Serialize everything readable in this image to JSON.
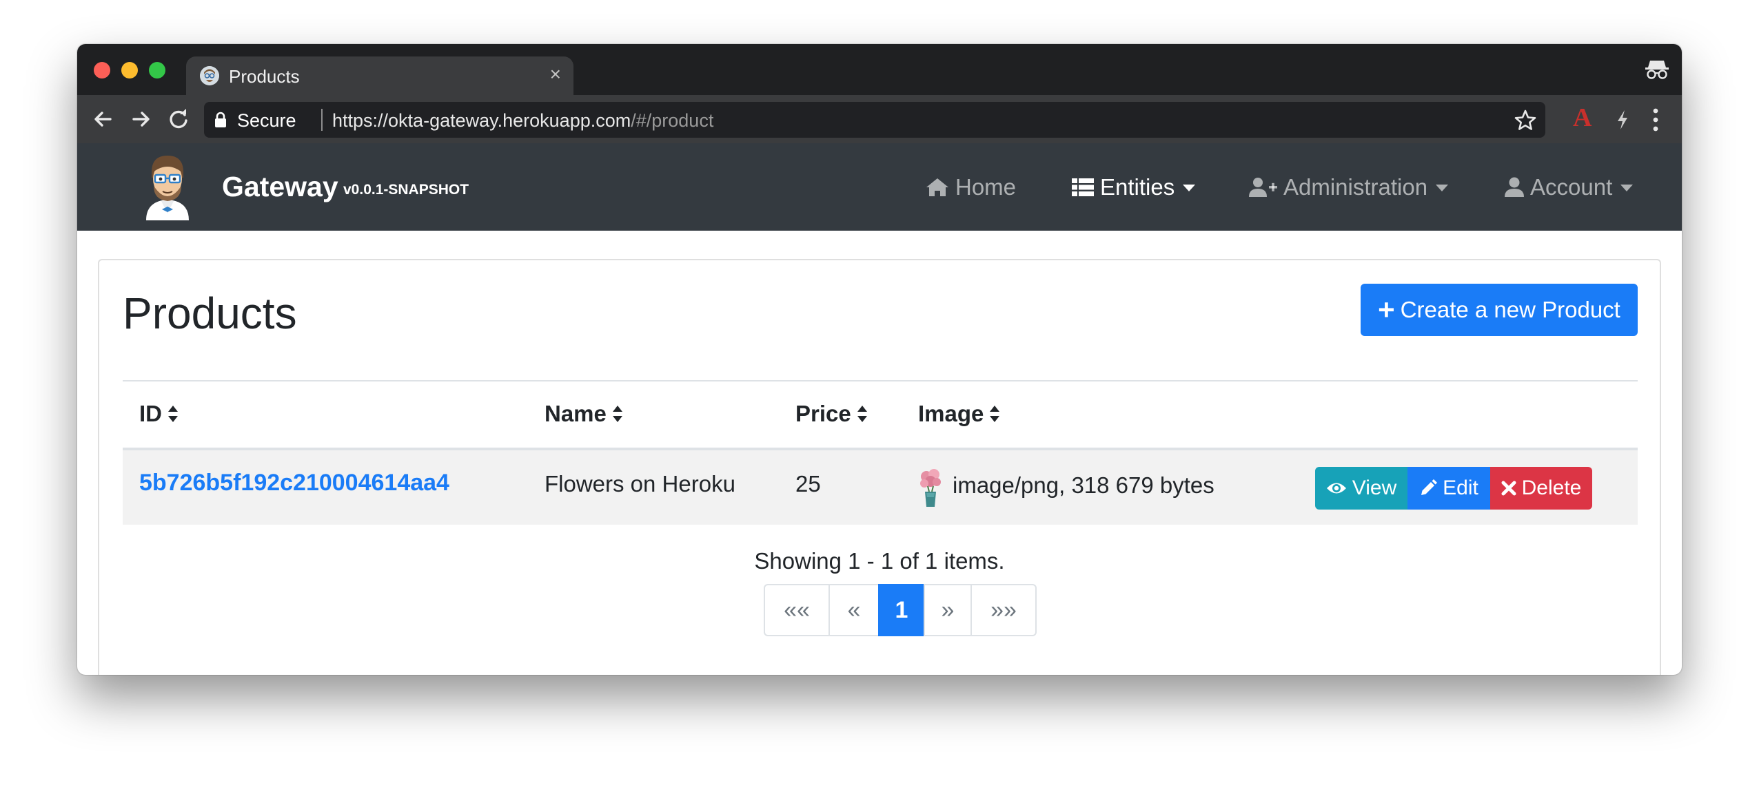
{
  "browser": {
    "tab_title": "Products",
    "tab_close": "×",
    "secure_label": "Secure",
    "url_base": "https://okta-gateway.herokuapp.com",
    "url_path": "/#/product",
    "extension_label": "A"
  },
  "navbar": {
    "brand": "Gateway",
    "version": "v0.0.1-SNAPSHOT",
    "items": [
      {
        "label": "Home",
        "icon": "home-icon"
      },
      {
        "label": "Entities",
        "icon": "list-icon"
      },
      {
        "label": "Administration",
        "icon": "user-plus-icon"
      },
      {
        "label": "Account",
        "icon": "user-icon"
      }
    ]
  },
  "page": {
    "title": "Products",
    "create_button": "Create a new Product",
    "create_icon": "+"
  },
  "table": {
    "columns": [
      "ID",
      "Name",
      "Price",
      "Image"
    ],
    "rows": [
      {
        "id": "5b726b5f192c210004614aa4",
        "name": "Flowers on Heroku",
        "price": "25",
        "image": "image/png, 318 679 bytes"
      }
    ],
    "actions": {
      "view": "View",
      "edit": "Edit",
      "delete": "Delete"
    }
  },
  "footer": {
    "showing": "Showing 1 - 1 of 1 items.",
    "pages": [
      "««",
      "«",
      "1",
      "»",
      "»»"
    ],
    "current_page": 1
  },
  "colors": {
    "primary": "#1a7cf7",
    "info": "#17a2b8",
    "danger": "#dc3545",
    "navbar": "#343a40"
  }
}
